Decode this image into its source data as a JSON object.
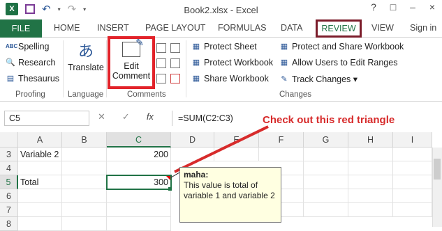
{
  "window": {
    "title": "Book2.xlsx - Excel",
    "controls": [
      "?",
      "□",
      "–",
      "×"
    ]
  },
  "tabs": {
    "file": "FILE",
    "home": "HOME",
    "insert": "INSERT",
    "page_layout": "PAGE LAYOUT",
    "formulas": "FORMULAS",
    "data": "DATA",
    "review": "REVIEW",
    "view": "VIEW",
    "sign_in": "Sign in"
  },
  "ribbon": {
    "proofing": {
      "label": "Proofing",
      "spelling": "Spelling",
      "research": "Research",
      "thesaurus": "Thesaurus"
    },
    "language": {
      "label": "Language",
      "translate": "Translate"
    },
    "comments": {
      "label": "Comments",
      "edit_comment_line1": "Edit",
      "edit_comment_line2": "Comment"
    },
    "changes": {
      "label": "Changes",
      "protect_sheet": "Protect Sheet",
      "protect_workbook": "Protect Workbook",
      "share_workbook": "Share Workbook",
      "protect_share": "Protect and Share Workbook",
      "allow_users": "Allow Users to Edit Ranges",
      "track_changes": "Track Changes ▾"
    }
  },
  "formula_bar": {
    "name_box": "C5",
    "cancel": "✕",
    "enter": "✓",
    "fx": "fx",
    "formula": "=SUM(C2:C3)"
  },
  "grid": {
    "columns": [
      "A",
      "B",
      "C",
      "D",
      "E",
      "F",
      "G",
      "H",
      "I"
    ],
    "rows": [
      "3",
      "4",
      "5",
      "6",
      "7",
      "8"
    ],
    "cells": {
      "A3": "Variable 2",
      "C3": "200",
      "A5": "Total",
      "C5": "300"
    }
  },
  "comment": {
    "author": "maha:",
    "text": "This value is total of variable 1 and variable 2"
  },
  "annotation": {
    "text": "Check out this red triangle",
    "color": "#d72b2b"
  },
  "colors": {
    "excel_green": "#217346",
    "highlight_red": "#e2232a",
    "review_border": "#7b1c2a"
  }
}
